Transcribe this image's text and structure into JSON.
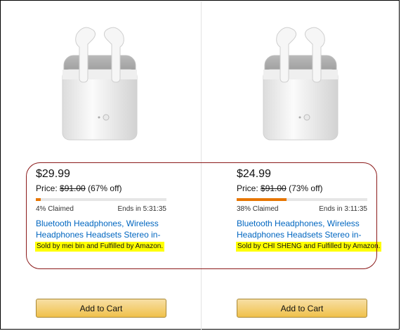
{
  "deals": [
    {
      "price": "$29.99",
      "list_price_label": "Price:",
      "list_price": "$91.00",
      "discount": "(67% off)",
      "claimed_percent": 4,
      "claimed_text": "4% Claimed",
      "ends_text": "Ends in 5:31:35",
      "title": "Bluetooth Headphones, Wireless Headphones Headsets Stereo in-E...",
      "sold_by": "Sold by mei bin and Fulfilled by Amazon.",
      "button_label": "Add to Cart",
      "image_icon": "wireless-earbuds-case-image"
    },
    {
      "price": "$24.99",
      "list_price_label": "Price:",
      "list_price": "$91.00",
      "discount": "(73% off)",
      "claimed_percent": 38,
      "claimed_text": "38% Claimed",
      "ends_text": "Ends in 3:11:35",
      "title": "Bluetooth Headphones, Wireless Headphones Headsets Stereo in-E...",
      "sold_by": "Sold by CHI SHENG and Fulfilled by Amazon.",
      "button_label": "Add to Cart",
      "image_icon": "wireless-earbuds-case-image"
    }
  ],
  "colors": {
    "progress_fill": "#e77600",
    "link": "#0066c0",
    "highlight": "#ffff00",
    "annotation": "#8b1a1a",
    "button": "#f0c14b"
  }
}
